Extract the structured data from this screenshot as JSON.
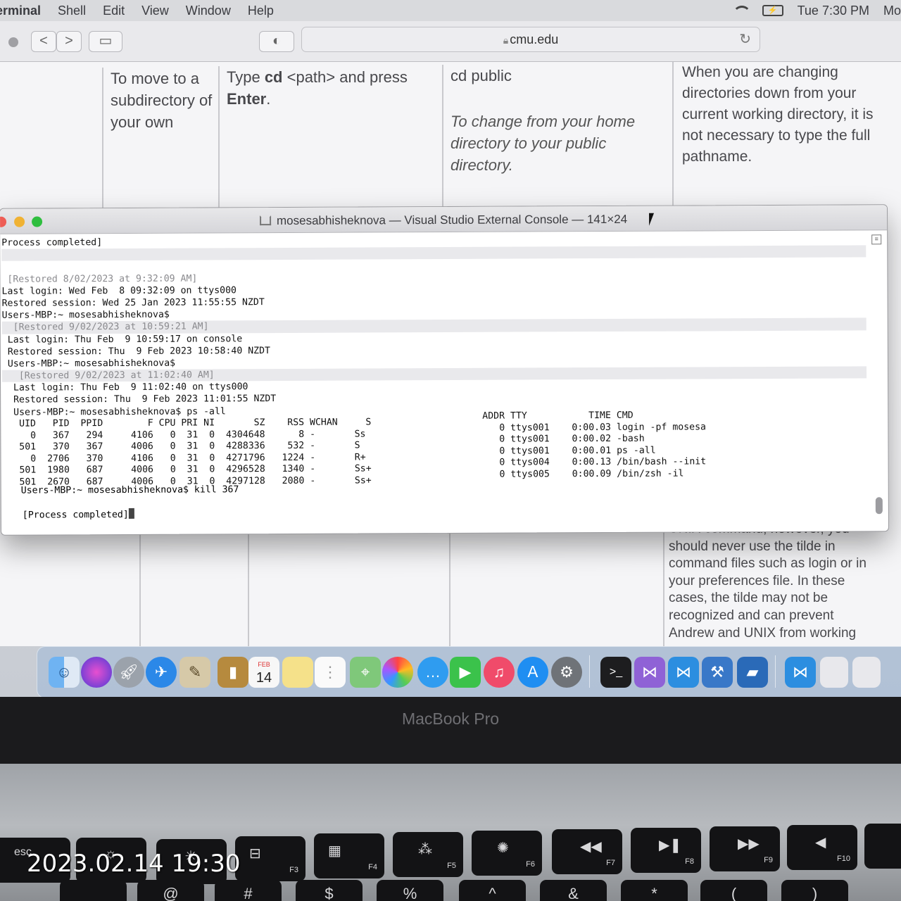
{
  "menubar": {
    "app": "erminal",
    "items": [
      "Shell",
      "Edit",
      "View",
      "Window",
      "Help"
    ],
    "clock": "Tue 7:30 PM",
    "user": "Mo"
  },
  "browser": {
    "url": "cmu.edu",
    "back": "<",
    "forward": ">"
  },
  "table": {
    "col1": "To move to a subdirectory of your own",
    "col2_pre": "Type ",
    "col2_cmd": "cd",
    "col2_mid": " <path> and press ",
    "col2_key": "Enter",
    "col2_end": ".",
    "col3_cmd": "cd public",
    "col3_desc": "To change from your home directory to your public directory.",
    "col4": "When you are changing directories down from your current working directory, it is not necessary to type the full pathname."
  },
  "lower_text": "UNIX command, however, you should never use the tilde in command files such as login or in your preferences file. In these cases, the tilde may not be recognized and can prevent Andrew and UNIX from working",
  "terminal": {
    "title": "mosesabhisheknova — Visual Studio External Console — 141×24",
    "lines": [
      "Process completed]",
      "",
      "",
      " [Restored 8/02/2023 at 9:32:09 AM]",
      "Last login: Wed Feb  8 09:32:09 on ttys000",
      "Restored session: Wed 25 Jan 2023 11:55:55 NZDT",
      "Users-MBP:~ mosesabhisheknova$",
      "  [Restored 9/02/2023 at 10:59:21 AM]",
      " Last login: Thu Feb  9 10:59:17 on console",
      " Restored session: Thu  9 Feb 2023 10:58:40 NZDT",
      " Users-MBP:~ mosesabhisheknova$",
      "   [Restored 9/02/2023 at 11:02:40 AM]",
      "  Last login: Thu Feb  9 11:02:40 on ttys000",
      "  Restored session: Thu  9 Feb 2023 11:01:55 NZDT",
      "  Users-MBP:~ mosesabhisheknova$ ps -all"
    ],
    "ps_left": "   UID   PID  PPID        F CPU PRI NI       SZ    RSS WCHAN     S\n     0   367   294     4106   0  31  0  4304648      8 -       Ss\n   501   370   367     4006   0  31  0  4288336    532 -       S\n     0  2706   370     4106   0  31  0  4271796   1224 -       R+\n   501  1980   687     4006   0  31  0  4296528   1340 -       Ss+\n   501  2670   687     4006   0  31  0  4297128   2080 -       Ss+",
    "ps_right": "ADDR TTY           TIME CMD\n   0 ttys001    0:00.03 login -pf mosesa\n   0 ttys001    0:00.02 -bash\n   0 ttys001    0:00.01 ps -all\n   0 ttys004    0:00.13 /bin/bash --init\n   0 ttys005    0:00.09 /bin/zsh -il",
    "kill_line": "Users-MBP:~ mosesabhisheknova$ kill 367",
    "final_line": "[Process completed]"
  },
  "dock": {
    "calendar_month": "FEB",
    "calendar_day": "14"
  },
  "laptop": {
    "brand": "MacBook Pro"
  },
  "keyboard": {
    "esc": "esc",
    "f3": "F3",
    "f4": "F4",
    "f5": "F5",
    "f6": "F6",
    "f7": "F7",
    "f8": "F8",
    "f9": "F9",
    "f10": "F10",
    "row2": [
      "@",
      "#",
      "$",
      "%",
      "^",
      "&",
      "*",
      "(",
      ")"
    ]
  },
  "photo_timestamp": "2023.02.14 19:30"
}
